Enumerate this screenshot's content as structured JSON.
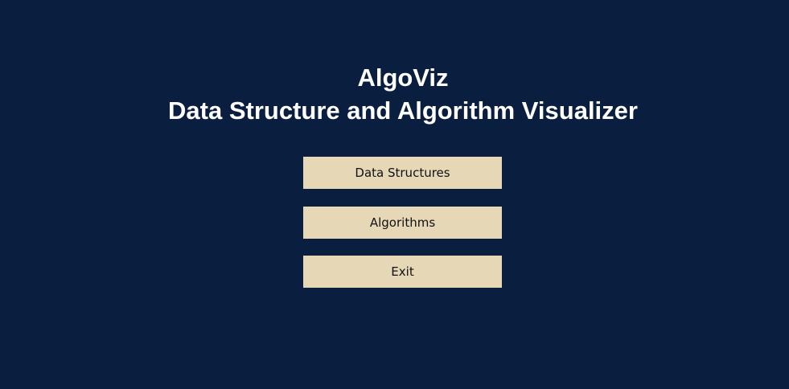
{
  "app": {
    "name": "AlgoViz",
    "subtitle": "Data Structure and Algorithm Visualizer"
  },
  "menu": {
    "data_structures_label": "Data Structures",
    "algorithms_label": "Algorithms",
    "exit_label": "Exit"
  },
  "colors": {
    "background": "#0a1f3f",
    "button": "#e6d8b6",
    "title_text": "#ffffff",
    "button_text": "#111111"
  }
}
